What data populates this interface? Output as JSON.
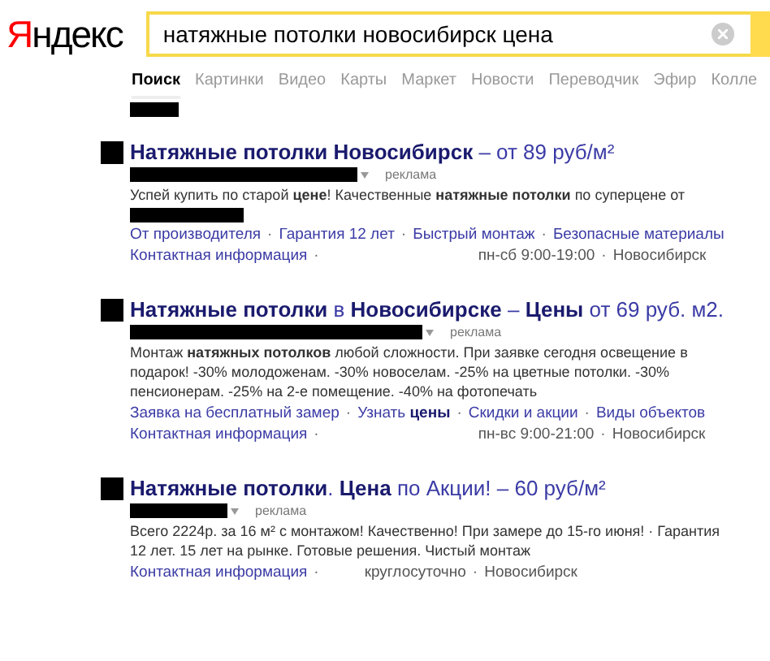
{
  "logo": "Яндекс",
  "search": {
    "value": "натяжные потолки новосибирск цена"
  },
  "tabs": [
    {
      "label": "Поиск",
      "selected": true
    },
    {
      "label": "Картинки",
      "selected": false
    },
    {
      "label": "Видео",
      "selected": false
    },
    {
      "label": "Карты",
      "selected": false
    },
    {
      "label": "Маркет",
      "selected": false
    },
    {
      "label": "Новости",
      "selected": false
    },
    {
      "label": "Переводчик",
      "selected": false
    },
    {
      "label": "Эфир",
      "selected": false
    },
    {
      "label": "Колле",
      "selected": false
    }
  ],
  "separator": "·",
  "results": [
    {
      "title": "**Натяжные потолки Новосибирск** – от 89 руб/м²",
      "ad_label": "реклама",
      "description": "Успей купить по старой **цене**! Качественные **натяжные потолки** по суперцене от",
      "redacted_line": true,
      "sitelinks": [
        "От производителя",
        "Гарантия 12 лет",
        "Быстрый монтаж",
        "Безопасные материалы"
      ],
      "contact": "Контактная информация",
      "meta": [
        "пн-сб 9:00-19:00",
        "Новосибирск"
      ]
    },
    {
      "title": "**Натяжные потолки** в **Новосибирске** – **Цены** от 69 руб. м2.",
      "ad_label": "реклама",
      "description": "Монтаж **натяжных потолков** любой сложности. При заявке сегодня освещение в подарок!  -30% молодоженам. -30% новоселам. -25% на цветные потолки. -30% пенсионерам. -25% на 2-е помещение. -40% на фотопечать",
      "redacted_line": false,
      "sitelinks": [
        "Заявка на бесплатный замер",
        "Узнать **цены**",
        "Скидки и акции",
        "Виды объектов"
      ],
      "contact": "Контактная информация",
      "meta": [
        "пн-вс 9:00-21:00",
        "Новосибирск"
      ]
    },
    {
      "title": "**Натяжные потолки**. **Цена** по Акции! – 60 руб/м²",
      "ad_label": "реклама",
      "description": "Всего 2224р. за 16 м² с монтажом! Качественно! При замере до 15-го июня! · Гарантия 12 лет. 15 лет на рынке. Готовые решения. Чистый монтаж",
      "redacted_line": false,
      "contact": "Контактная информация",
      "meta": [
        "круглосуточно",
        "Новосибирск"
      ]
    }
  ]
}
